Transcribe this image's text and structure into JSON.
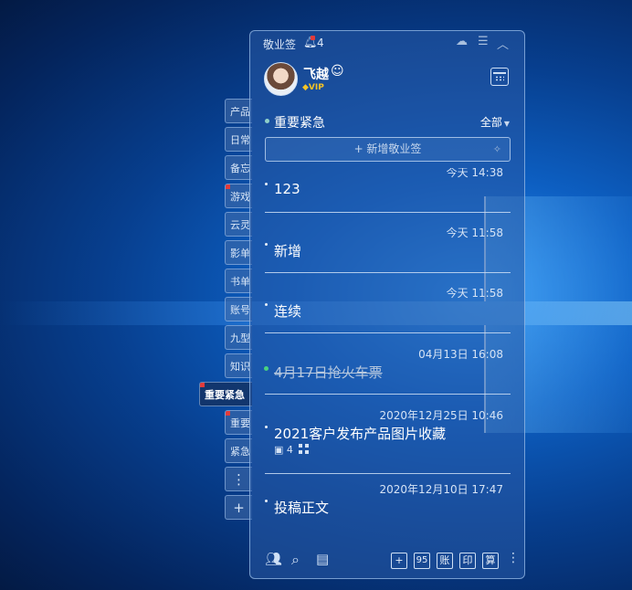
{
  "desktop": {
    "accent": "#0d5fc2"
  },
  "side_tabs": [
    {
      "label": "产品",
      "flag": false
    },
    {
      "label": "日常",
      "flag": false
    },
    {
      "label": "备忘",
      "flag": false
    },
    {
      "label": "游戏",
      "flag": true
    },
    {
      "label": "云灵",
      "flag": false
    },
    {
      "label": "影单",
      "flag": false
    },
    {
      "label": "书单",
      "flag": false
    },
    {
      "label": "账号",
      "flag": false
    },
    {
      "label": "九型",
      "flag": false
    },
    {
      "label": "知识",
      "flag": false
    },
    {
      "label": "重要紧急",
      "flag": true,
      "active": true
    },
    {
      "label": "重要",
      "flag": true
    },
    {
      "label": "紧急",
      "flag": false
    },
    {
      "label": "⋮",
      "flag": false
    },
    {
      "label": "+",
      "flag": false
    }
  ],
  "titlebar": {
    "app_title": "敬业签",
    "bell_icon": "bell-icon",
    "notification_count": "4",
    "icons": [
      "cloud-icon",
      "menu-icon",
      "collapse-icon"
    ]
  },
  "user": {
    "name": "飞越",
    "emoji": "☺",
    "badge": "VIP",
    "calendar_icon": "calendar-icon"
  },
  "category": {
    "title": "重要紧急",
    "filter": "全部",
    "filter_caret": "▼"
  },
  "new_note": {
    "label": "+ 新增敬业签",
    "sparkle": "✧"
  },
  "notes": [
    {
      "time": "今天 14:38",
      "title": "123",
      "done": false
    },
    {
      "time": "今天 11:58",
      "title": "新增",
      "done": false
    },
    {
      "time": "今天 11:58",
      "title": "连续",
      "done": false
    },
    {
      "time": "04月13日 16:08",
      "title": "4月17日抢火车票",
      "done": true
    },
    {
      "time": "2020年12月25日 10:46",
      "title": "2021客户发布产品图片收藏",
      "done": false,
      "images": "4"
    },
    {
      "time": "2020年12月10日 17:47",
      "title": "投稿正文",
      "done": false
    }
  ],
  "bottom_toolbar": {
    "left_icons": [
      "contacts-icon",
      "search-icon",
      "notes-icon"
    ],
    "buttons": [
      "+",
      "95",
      "账",
      "印",
      "算"
    ],
    "more": "⋮"
  }
}
